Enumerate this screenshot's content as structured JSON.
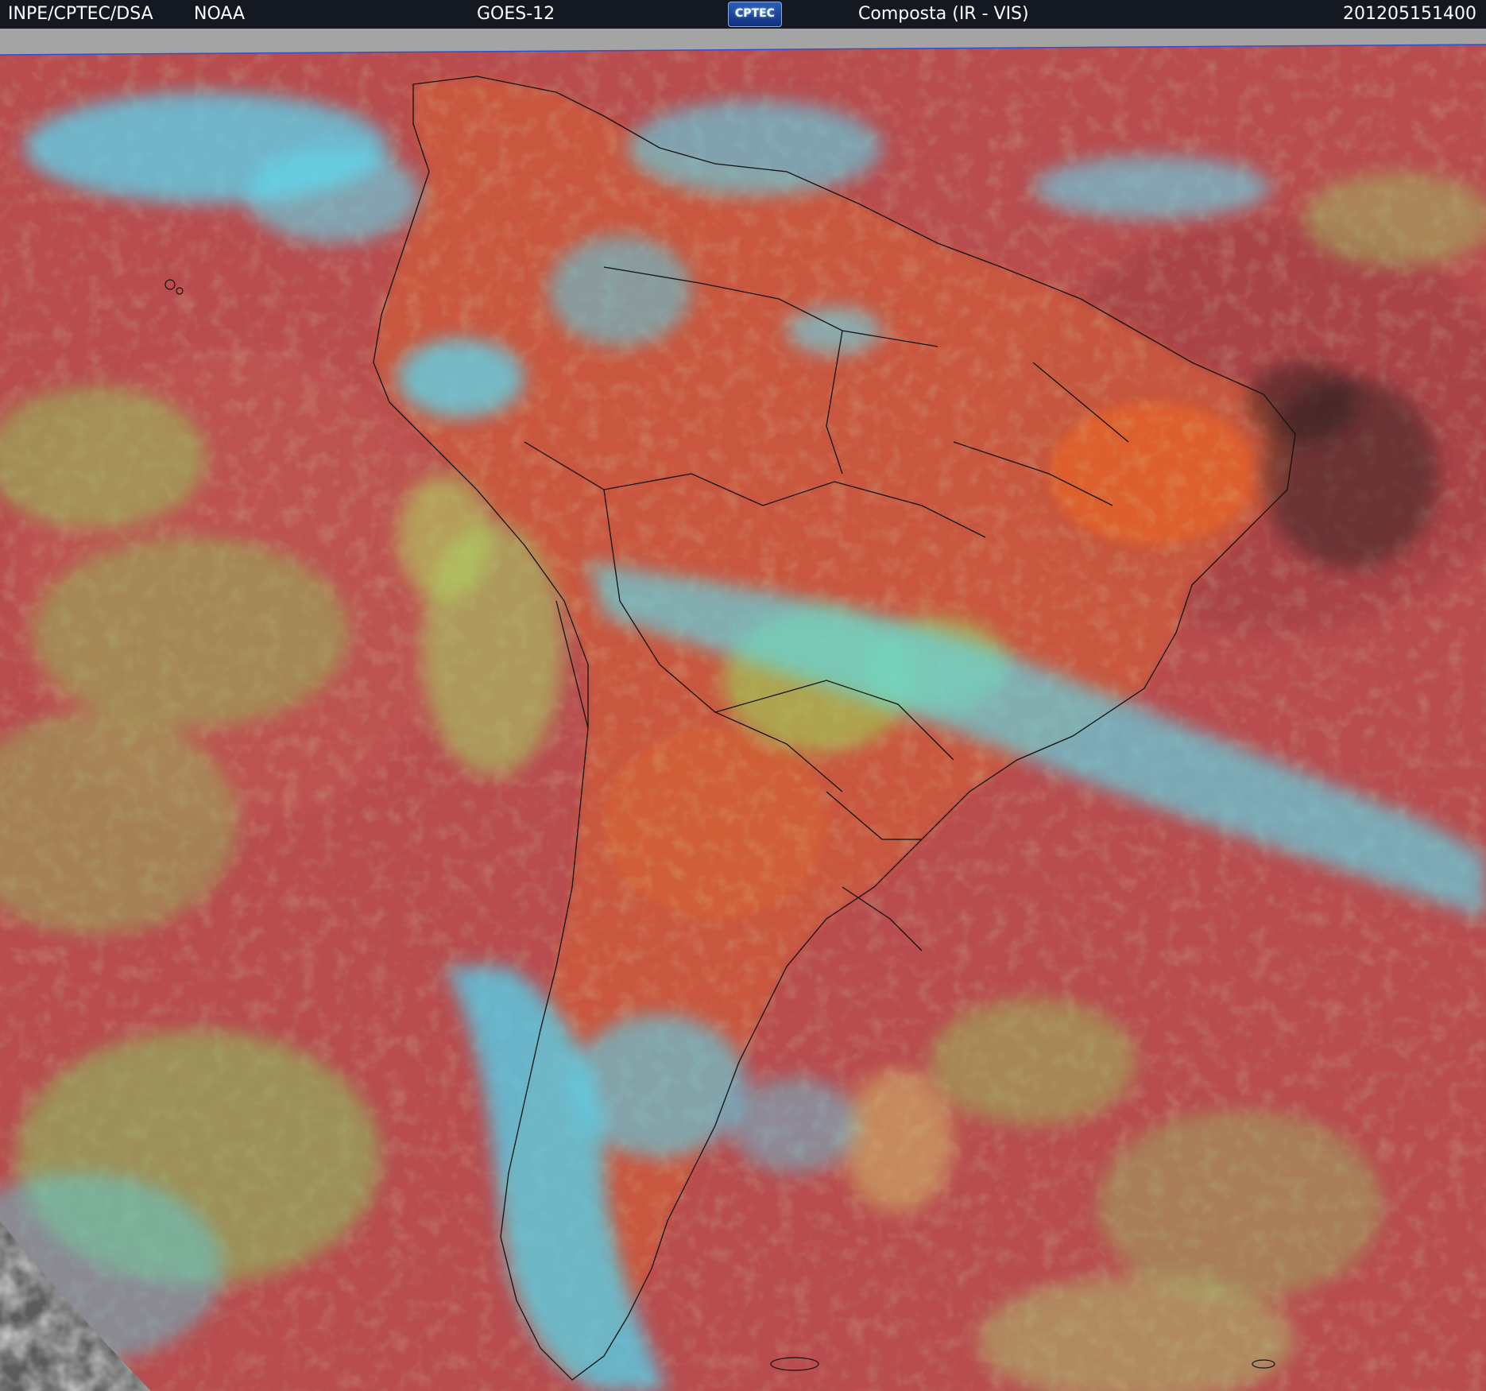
{
  "header": {
    "org_left": "INPE/CPTEC/DSA",
    "org_noaa": "NOAA",
    "satellite": "GOES-12",
    "logo_text": "CPTEC",
    "product": "Composta (IR - VIS)",
    "timestamp": "201205151400"
  },
  "colors": {
    "background_red": "#b44848",
    "cloud_cyan": "#52e0ff",
    "cloud_green": "#9ad060",
    "land_orange": "#d2603a",
    "space_gray": "#9a9a9a",
    "border_black": "#111111"
  }
}
